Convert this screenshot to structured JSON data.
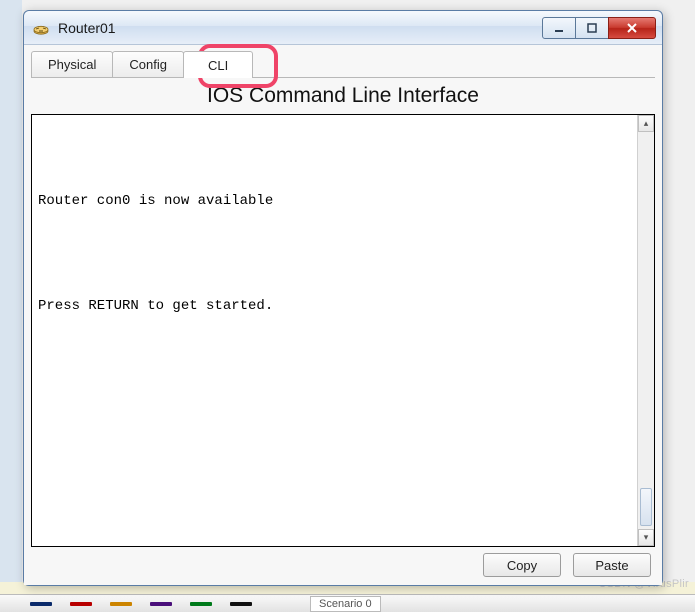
{
  "window": {
    "title": "Router01"
  },
  "tabs": [
    {
      "label": "Physical"
    },
    {
      "label": "Config"
    },
    {
      "label": "CLI",
      "active": true
    }
  ],
  "pane": {
    "title": "IOS Command Line Interface"
  },
  "terminal": {
    "lines": [
      "",
      "",
      "",
      "",
      "Router con0 is now available",
      "",
      "",
      "",
      "",
      "",
      "Press RETURN to get started.",
      "",
      "",
      "",
      "",
      "",
      "",
      "",
      ""
    ]
  },
  "buttons": {
    "copy": "Copy",
    "paste": "Paste"
  },
  "background": {
    "scenario_label": "Scenario 0",
    "watermark": "CSDN @VirusPlir"
  }
}
